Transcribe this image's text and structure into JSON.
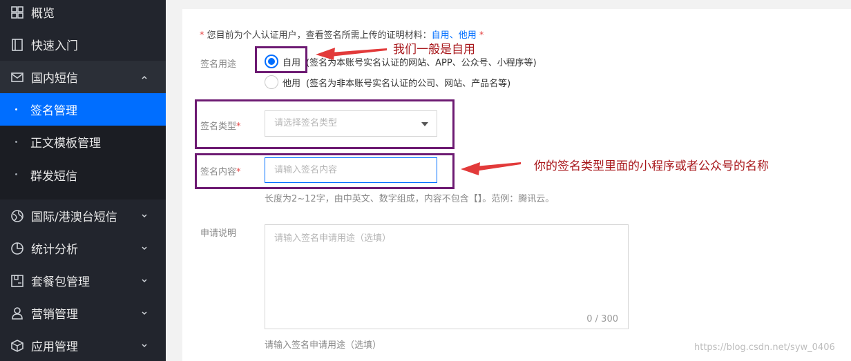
{
  "sidebar": {
    "items": [
      {
        "label": "概览"
      },
      {
        "label": "快速入门"
      },
      {
        "label": "国内短信"
      },
      {
        "label": "签名管理"
      },
      {
        "label": "正文模板管理"
      },
      {
        "label": "群发短信"
      },
      {
        "label": "国际/港澳台短信"
      },
      {
        "label": "统计分析"
      },
      {
        "label": "套餐包管理"
      },
      {
        "label": "营销管理"
      },
      {
        "label": "应用管理"
      }
    ]
  },
  "form": {
    "notice_star": "*",
    "notice_text": "您目前为个人认证用户，查看签名所需上传的证明材料：",
    "notice_link_self": "自用",
    "notice_sep": "、",
    "notice_link_other": "他用",
    "notice_star_end": "*",
    "usage": {
      "label": "签名用途",
      "options": [
        {
          "label": "自用",
          "desc": "(签名为本账号实名认证的网站、APP、公众号、小程序等)",
          "checked": true
        },
        {
          "label": "他用",
          "desc": "(签名为非本账号实名认证的公司、网站、产品名等)",
          "checked": false
        }
      ]
    },
    "type": {
      "label": "签名类型",
      "required": "*",
      "placeholder": "请选择签名类型"
    },
    "content": {
      "label": "签名内容",
      "required": "*",
      "placeholder": "请输入签名内容",
      "hint": "长度为2~12字，由中英文、数字组成，内容不包含【】。范例：腾讯云。"
    },
    "description": {
      "label": "申请说明",
      "placeholder": "请输入签名申请用途（选填）",
      "counter": "0 / 300",
      "hint": "请输入签名申请用途（选填）"
    }
  },
  "annotations": {
    "note1": "我们一般是自用",
    "note2": "你的签名类型里面的小程序或者公众号的名称",
    "color": "#a8171b",
    "box_color": "#6d1a72"
  },
  "watermark": "https://blog.csdn.net/syw_0406"
}
